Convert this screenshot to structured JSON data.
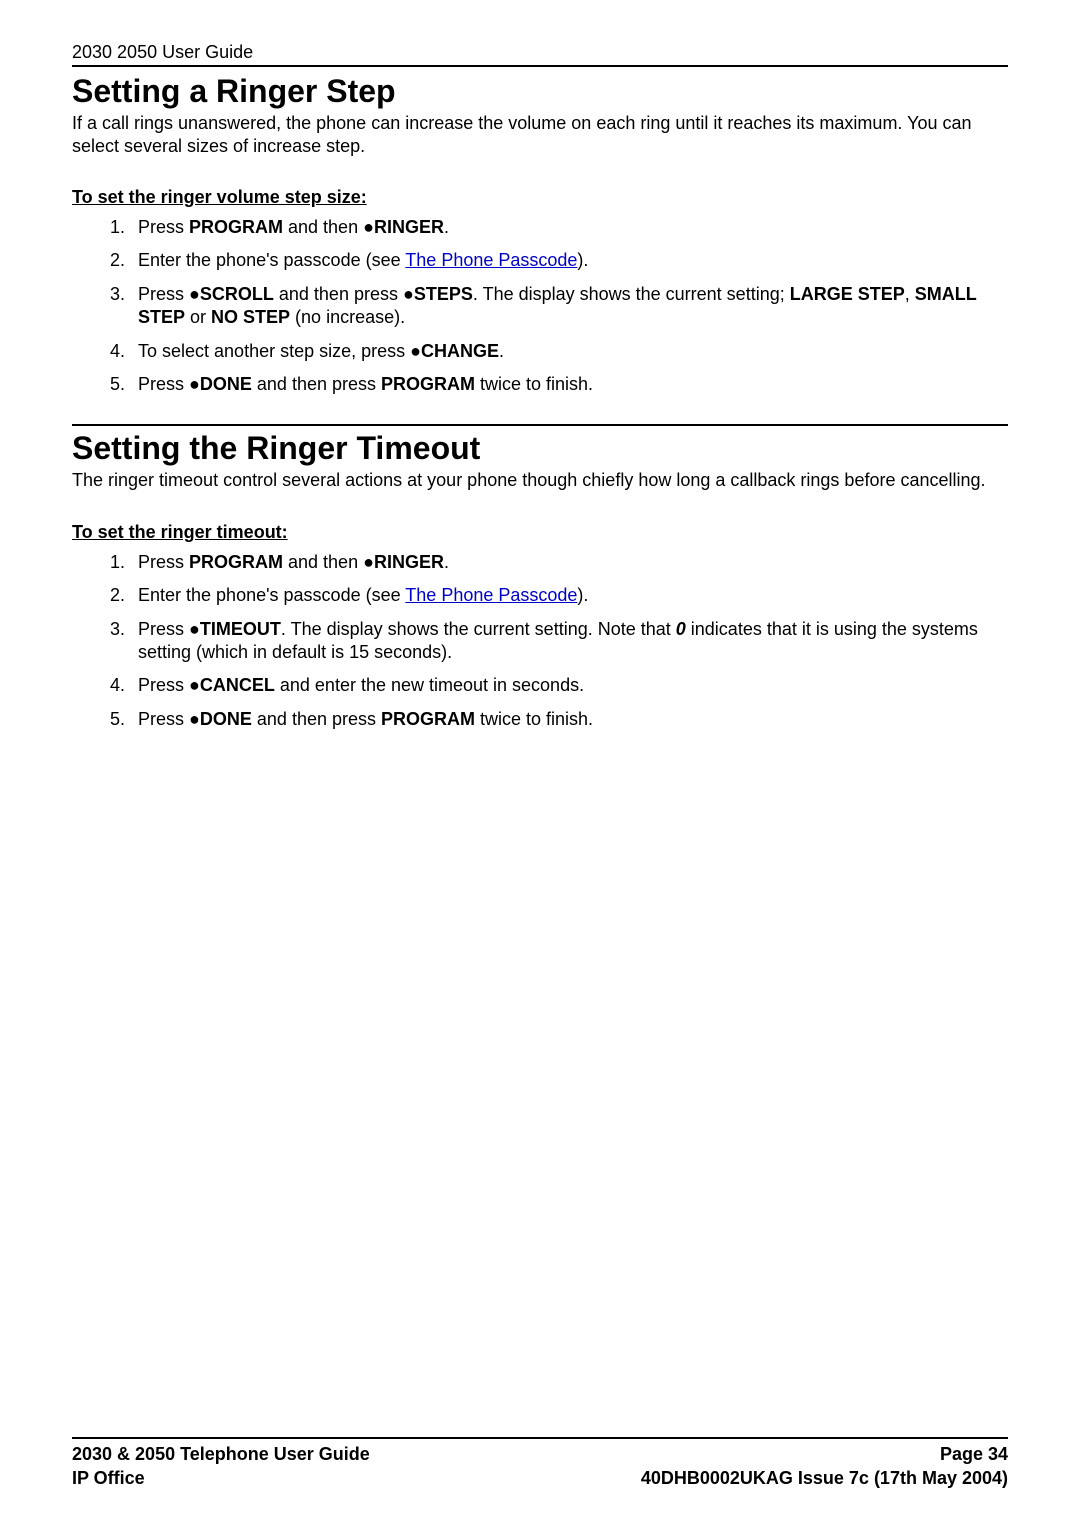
{
  "header": {
    "title": "2030 2050 User Guide"
  },
  "section1": {
    "title": "Setting a Ringer Step",
    "intro": "If a call rings unanswered, the phone can increase the volume on each ring until it reaches its maximum. You can select several sizes of increase step.",
    "subheading": "To set the ringer volume step size:",
    "steps": {
      "s1_a": "Press ",
      "s1_b": "PROGRAM",
      "s1_c": " and then ",
      "s1_d": "RINGER",
      "s1_e": ".",
      "s2_a": "Enter the phone's passcode (see ",
      "s2_link": "The Phone Passcode",
      "s2_b": ").",
      "s3_a": "Press ",
      "s3_b": "SCROLL",
      "s3_c": " and then press ",
      "s3_d": "STEPS",
      "s3_e": ". The display shows the current setting; ",
      "s3_f": "LARGE STEP",
      "s3_g": ", ",
      "s3_h": "SMALL STEP",
      "s3_i": " or ",
      "s3_j": "NO STEP",
      "s3_k": " (no increase).",
      "s4_a": "To select another step size, press ",
      "s4_b": "CHANGE",
      "s4_c": ".",
      "s5_a": "Press ",
      "s5_b": "DONE",
      "s5_c": " and then press ",
      "s5_d": "PROGRAM",
      "s5_e": " twice to finish."
    }
  },
  "section2": {
    "title": "Setting the Ringer Timeout",
    "intro": "The ringer timeout control several actions at your phone though chiefly how long a callback rings before cancelling.",
    "subheading": "To set the ringer timeout:",
    "steps": {
      "s1_a": "Press ",
      "s1_b": "PROGRAM",
      "s1_c": " and then ",
      "s1_d": "RINGER",
      "s1_e": ".",
      "s2_a": "Enter the phone's passcode (see ",
      "s2_link": "The Phone Passcode",
      "s2_b": ").",
      "s3_a": "Press ",
      "s3_b": "TIMEOUT",
      "s3_c": ". The display shows the current setting. Note that ",
      "s3_d": "0",
      "s3_e": " indicates that it is using the systems setting (which in default is 15 seconds).",
      "s4_a": "Press ",
      "s4_b": "CANCEL",
      "s4_c": " and enter the new timeout in seconds.",
      "s5_a": "Press ",
      "s5_b": "DONE",
      "s5_c": " and then press ",
      "s5_d": "PROGRAM",
      "s5_e": " twice to finish."
    }
  },
  "footer": {
    "left1": "2030 & 2050 Telephone User Guide",
    "right1": "Page 34",
    "left2": "IP Office",
    "right2": "40DHB0002UKAG Issue 7c (17th May 2004)"
  },
  "glyph": {
    "bullet": "●"
  }
}
